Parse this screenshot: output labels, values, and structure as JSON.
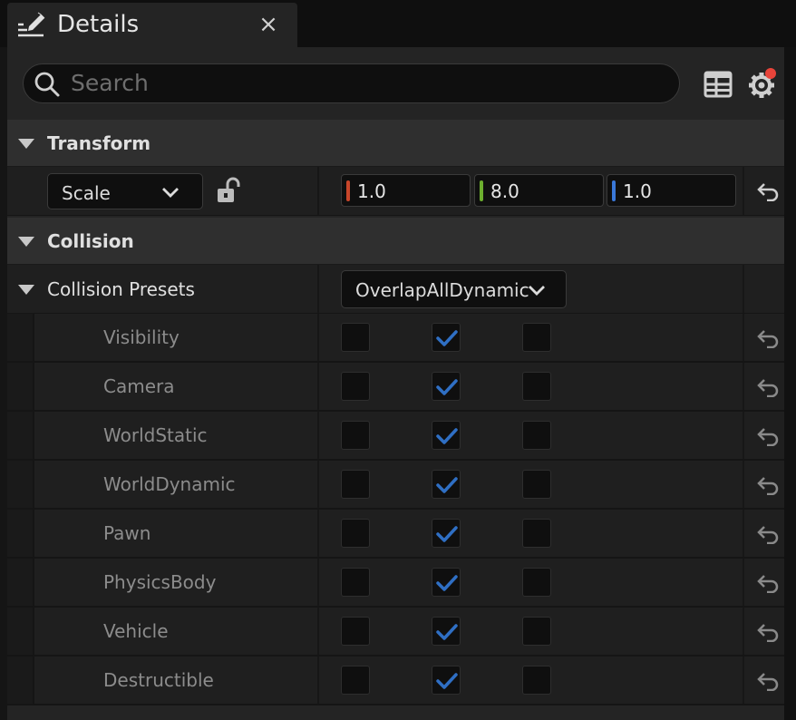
{
  "tab": {
    "title": "Details",
    "close_label": "×",
    "icon": "edit-icon"
  },
  "search": {
    "placeholder": "Search"
  },
  "toolbar": {
    "grid_icon": "property-matrix-icon",
    "settings_icon": "settings-gear-icon",
    "settings_badge_color": "#e8443a"
  },
  "sections": {
    "transform": {
      "title": "Transform"
    },
    "collision": {
      "title": "Collision"
    }
  },
  "transform": {
    "mode_dropdown": "Scale",
    "lock_icon": "unlock-icon",
    "values": [
      {
        "value": "1.0",
        "color": "#c8462a"
      },
      {
        "value": "8.0",
        "color": "#6cae2e"
      },
      {
        "value": "1.0",
        "color": "#3a78d8"
      }
    ]
  },
  "collision": {
    "presets_label": "Collision Presets",
    "presets_value": "OverlapAllDynamic",
    "channels": [
      {
        "name": "Visibility",
        "checked": [
          false,
          true,
          false
        ]
      },
      {
        "name": "Camera",
        "checked": [
          false,
          true,
          false
        ]
      },
      {
        "name": "WorldStatic",
        "checked": [
          false,
          true,
          false
        ]
      },
      {
        "name": "WorldDynamic",
        "checked": [
          false,
          true,
          false
        ]
      },
      {
        "name": "Pawn",
        "checked": [
          false,
          true,
          false
        ]
      },
      {
        "name": "PhysicsBody",
        "checked": [
          false,
          true,
          false
        ]
      },
      {
        "name": "Vehicle",
        "checked": [
          false,
          true,
          false
        ]
      },
      {
        "name": "Destructible",
        "checked": [
          false,
          true,
          false
        ]
      }
    ]
  },
  "colors": {
    "accent_check": "#2f6fc4",
    "panel_bg": "#242424",
    "field_bg": "#0f0f0f"
  }
}
